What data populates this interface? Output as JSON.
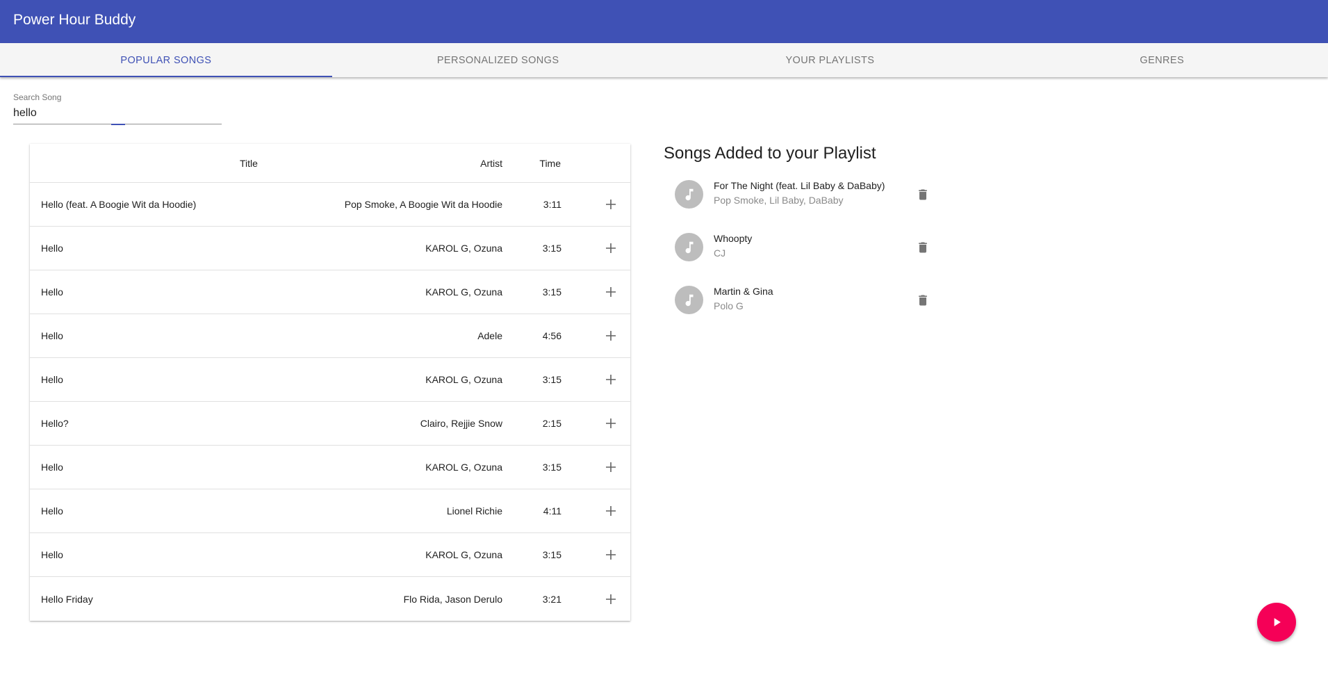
{
  "app": {
    "title": "Power Hour Buddy"
  },
  "tabs": [
    {
      "label": "Popular Songs",
      "active": true
    },
    {
      "label": "Personalized Songs",
      "active": false
    },
    {
      "label": "Your Playlists",
      "active": false
    },
    {
      "label": "Genres",
      "active": false
    }
  ],
  "search": {
    "label": "Search Song",
    "value": "hello"
  },
  "table": {
    "headers": {
      "title": "Title",
      "artist": "Artist",
      "time": "Time"
    },
    "rows": [
      {
        "title": "Hello (feat. A Boogie Wit da Hoodie)",
        "artist": "Pop Smoke, A Boogie Wit da Hoodie",
        "time": "3:11"
      },
      {
        "title": "Hello",
        "artist": "KAROL G, Ozuna",
        "time": "3:15"
      },
      {
        "title": "Hello",
        "artist": "KAROL G, Ozuna",
        "time": "3:15"
      },
      {
        "title": "Hello",
        "artist": "Adele",
        "time": "4:56"
      },
      {
        "title": "Hello",
        "artist": "KAROL G, Ozuna",
        "time": "3:15"
      },
      {
        "title": "Hello?",
        "artist": "Clairo, Rejjie Snow",
        "time": "2:15"
      },
      {
        "title": "Hello",
        "artist": "KAROL G, Ozuna",
        "time": "3:15"
      },
      {
        "title": "Hello",
        "artist": "Lionel Richie",
        "time": "4:11"
      },
      {
        "title": "Hello",
        "artist": "KAROL G, Ozuna",
        "time": "3:15"
      },
      {
        "title": "Hello Friday",
        "artist": "Flo Rida, Jason Derulo",
        "time": "3:21"
      }
    ],
    "add_icon": "plus-icon"
  },
  "playlist": {
    "heading": "Songs Added to your Playlist",
    "items": [
      {
        "title": "For The Night (feat. Lil Baby & DaBaby)",
        "artist": "Pop Smoke, Lil Baby, DaBaby"
      },
      {
        "title": "Whoopty",
        "artist": "CJ"
      },
      {
        "title": "Martin & Gina",
        "artist": "Polo G"
      }
    ],
    "avatar_icon": "music-note-icon",
    "delete_icon": "trash-icon"
  },
  "fab": {
    "icon": "play-icon"
  },
  "colors": {
    "primary": "#3f51b5",
    "accent": "#f50057",
    "avatar": "#bdbdbd",
    "icon": "#757575"
  }
}
